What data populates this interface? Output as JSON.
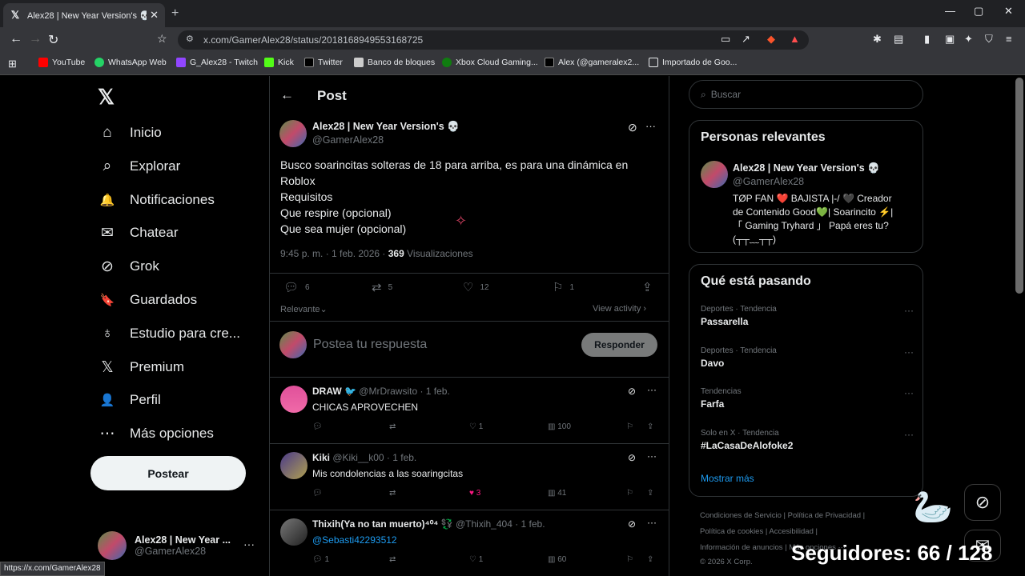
{
  "browser": {
    "tab_title": "Alex28 | New Year Version's 💀 o",
    "tab_close": "✕",
    "new_tab": "+",
    "window_min": "—",
    "window_max": "▢",
    "window_close": "✕",
    "url": "x.com/GamerAlex28/status/2018168949553168725",
    "status_url": "https://x.com/GamerAlex28",
    "bookmarks": [
      {
        "label": "YouTube",
        "color": "#ff0000"
      },
      {
        "label": "WhatsApp Web",
        "color": "#25d366"
      },
      {
        "label": "G_Alex28 - Twitch",
        "color": "#9146ff"
      },
      {
        "label": "Kick",
        "color": "#53fc18"
      },
      {
        "label": "Twitter",
        "color": "#000000"
      },
      {
        "label": "Banco de bloques",
        "color": "#cccccc"
      },
      {
        "label": "Xbox Cloud Gaming...",
        "color": "#107c10"
      },
      {
        "label": "Alex (@gameralex2...",
        "color": "#000000"
      },
      {
        "label": "Importado de Goo...",
        "color": "#e8eaed"
      }
    ]
  },
  "sidebar": {
    "logo": "𝕏",
    "items": [
      {
        "label": "Inicio",
        "icon": "⌂"
      },
      {
        "label": "Explorar",
        "icon": "⌕"
      },
      {
        "label": "Notificaciones",
        "icon": "🔔"
      },
      {
        "label": "Chatear",
        "icon": "✉"
      },
      {
        "label": "Grok",
        "icon": "⊘"
      },
      {
        "label": "Guardados",
        "icon": "🔖"
      },
      {
        "label": "Estudio para cre...",
        "icon": "♁"
      },
      {
        "label": "Premium",
        "icon": "𝕏"
      },
      {
        "label": "Perfil",
        "icon": "👤"
      },
      {
        "label": "Más opciones",
        "icon": "⋯"
      }
    ],
    "post_button": "Postear",
    "account": {
      "name": "Alex28 | New Year ...",
      "handle": "@GamerAlex28",
      "more": "···"
    }
  },
  "post": {
    "header": "Post",
    "back": "←",
    "author_name": "Alex28 | New Year Version's 💀",
    "author_handle": "@GamerAlex28",
    "more": "···",
    "text_lines": [
      "Busco soarincitas solteras de 18 para arriba, es para una dinámica en",
      "Roblox",
      "Requisitos",
      "Que respire (opcional)",
      "Que sea mujer (opcional)"
    ],
    "timestamp": "9:45 p. m. · 1 feb. 2026 · ",
    "views_count": "369",
    "views_label": " Visualizaciones",
    "replies": "6",
    "reposts": "5",
    "likes": "12",
    "bookmarks": "1",
    "sort_label": "Relevante",
    "view_activity": "View activity ›",
    "reply_placeholder": "Postea tu respuesta",
    "reply_button": "Responder"
  },
  "replies": [
    {
      "name": "DRAW 🐦",
      "handle": "@MrDrawsito · 1 feb.",
      "text": "CHICAS APROVECHEN",
      "likes": "1",
      "views": "100",
      "liked": false
    },
    {
      "name": "Kiki",
      "handle": "@Kiki__k00 · 1 feb.",
      "text": "Mis condolencias a las soaringcitas",
      "likes": "3",
      "views": "41",
      "liked": true
    },
    {
      "name": "Thixih(Ya no tan muerto)⁴⁰⁴ 💱",
      "handle": "@Thixih_404 · 1 feb.",
      "text": "@Sebasti42293512",
      "likes": "1",
      "views": "60",
      "liked": false,
      "reply_count": "1"
    }
  ],
  "right": {
    "search_placeholder": "Buscar",
    "relevant_title": "Personas relevantes",
    "relevant_name": "Alex28 | New Year Version's 💀",
    "relevant_handle": "@GamerAlex28",
    "relevant_bio": [
      "TØP FAN ❤️ BAJISTA |-/ 🖤 Creador",
      "de Contenido Good💚| Soarincito ⚡|",
      "「 Gaming Tryhard 」 Papá eres tu?",
      "(┬┬﹏┬┬)"
    ],
    "trends_title": "Qué está pasando",
    "trends": [
      {
        "category": "Deportes · Tendencia",
        "name": "Passarella"
      },
      {
        "category": "Deportes · Tendencia",
        "name": "Davo"
      },
      {
        "category": "Tendencias",
        "name": "Farfa"
      },
      {
        "category": "Solo en X · Tendencia",
        "name": "#LaCasaDeAlofoke2"
      }
    ],
    "show_more": "Mostrar más",
    "footer_lines": [
      "Condiciones de Servicio  |  Política de Privacidad  |",
      "Política de cookies  |  Accesibilidad  |",
      "Información de anuncios  |  Más opciones ···",
      "© 2026 X Corp."
    ]
  },
  "overlay_text": "Seguidores: 66 / 128",
  "colors": {
    "accent": "#1d9bf0",
    "like": "#f91880"
  }
}
